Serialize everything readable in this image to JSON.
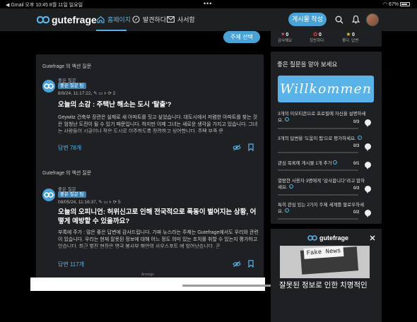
{
  "statusbar": {
    "left": "◀ Gmail  오후 10:45  8월 11일 일요일",
    "center": "•••",
    "right": "67%"
  },
  "nav": {
    "logo": "gutefrage",
    "home": "홈페이지",
    "explore": "발견하다",
    "messages": "사서함",
    "ask": "게시물 작성"
  },
  "topic_button": "주제 선택",
  "cards": [
    {
      "header": "Gutefrage 의 액션 질문",
      "user": "좋은 질문",
      "badge": "좋은 질문 팀",
      "meta": "8/9/24, 11:17:22,",
      "likes": "2",
      "title": "오늘의 소감 : 주택난 해소는 도시 '탈출'?",
      "body": "Geywitz 건축부 장관은 실제로 새 아파트를 짓고 싶었습니다. 대도시에서 저렴한 아파트를 찾는 것은 엄청난 도전이 될 수 있기 때문입니다. 하지만 이제 그녀는 새로운 생각을 가지고 있습니다. 그녀는 사람들이 시골이나 작은 도시로 이주하도록 장려하고 싶어합니다. 주택 부족 문",
      "answers": "답변 78개"
    },
    {
      "header": "Gutefrage 의 액션 질문",
      "user": "좋은 질문",
      "badge": "좋은 질문 팀",
      "meta": "08/05/24, 11:16:37,",
      "likes": "5",
      "title": "오늘의 오피니언: 허위신고로 인해 전국적으로 폭동이 벌어지는 상황, 어떻게 예방할 수 있을까요?",
      "body": "부록에 주가 : 많은 좋은 답변에 감사드립니다. 가짜 뉴스라는 주제는 Gutefrage에서도 우리와 관련이 있습니다. 우리는 현재 잘못된 정보에 대해 어느 정도 의미 있는 조치를 취할 수 있는지 평가하고 있습니다. 최근 벌진 현장은 영국 불사부 해안의 사우스포트 에 일어났습니다. 곤",
      "answers": "답변 117개"
    }
  ],
  "stats": [
    {
      "value": "0",
      "label": "감사해요"
    },
    {
      "value": "0",
      "label": "칭찬하다."
    },
    {
      "value": "0",
      "label": "좋다. 답변"
    }
  ],
  "panel": {
    "title": "좋은 질문을 알아 보세요",
    "welcome": "Willkommen"
  },
  "tasks": [
    {
      "text": "3개의 이모티콘으로 프로필에 자신을 설명하세요.",
      "count": "0/3",
      "progress": 0
    },
    {
      "text": "3개의 답변을 '도움이 됨'으로 평가하세요.",
      "count": "0/3",
      "progress": 0
    },
    {
      "text": "관심 목록에 게시물 1개 추가",
      "count": "0/1",
      "progress": 0
    },
    {
      "text": "열람한 사용자 3명에게 \"감사합니다\"라고 말하세요.",
      "count": "0/3",
      "progress": 0
    },
    {
      "text": "특히 관심 있는 2가지 주제 세계를 팔로우하세요.",
      "count": "0/2",
      "progress": 0
    }
  ],
  "ad": {
    "logo": "gutefrage",
    "image_text": "Fake News",
    "title": "잘못된 정보로 인한 치명적인",
    "label": "Anzeige"
  }
}
